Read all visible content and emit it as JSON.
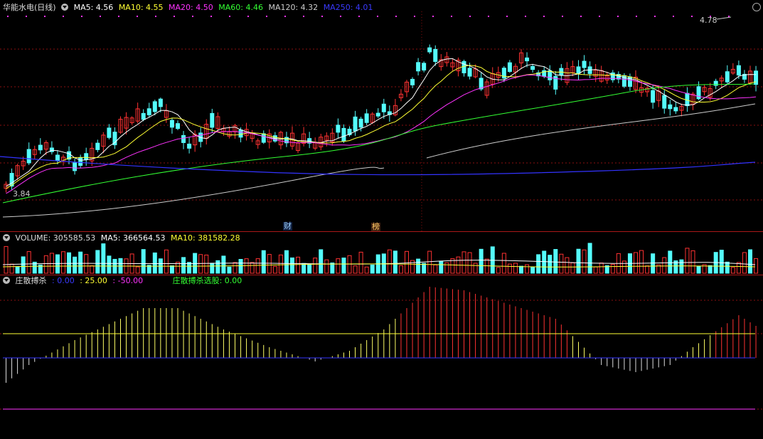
{
  "main": {
    "title": "华能水电(日线)",
    "ma": [
      {
        "label": "MA5: 4.56",
        "color": "#ffffff"
      },
      {
        "label": "MA10: 4.55",
        "color": "#ffff33"
      },
      {
        "label": "MA20: 4.50",
        "color": "#ff33ff"
      },
      {
        "label": "MA60: 4.46",
        "color": "#33ff33"
      },
      {
        "label": "MA120: 4.32",
        "color": "#cccccc"
      },
      {
        "label": "MA250: 4.01",
        "color": "#3333ff"
      }
    ],
    "high_label": "4.78",
    "low_label": "3.84",
    "tag_cai": "财",
    "tag_bang": "榜"
  },
  "volume": {
    "label": "VOLUME: 305585.53",
    "ma5": "MA5: 366564.53",
    "ma10": "MA10: 381582.28"
  },
  "indicator": {
    "name": "庄散搏杀",
    "v1": ": 0.00",
    "v2": ": 25.00",
    "v3": ": -50.00",
    "select": "庄散搏杀选股: 0.00"
  },
  "colors": {
    "up": "#ff3232",
    "down": "#54fcfc",
    "grid": "#8a1010"
  }
}
